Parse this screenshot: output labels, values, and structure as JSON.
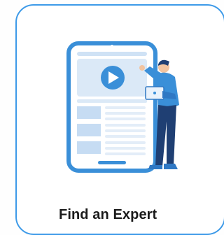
{
  "card": {
    "label": "Find an Expert",
    "illustration_icon": "expert-with-tablet-icon"
  },
  "colors": {
    "card_border": "#3d9ae8",
    "accent_blue": "#3a8fd8",
    "light_blue": "#dbe9f7",
    "label_text": "#1a1a1a"
  }
}
